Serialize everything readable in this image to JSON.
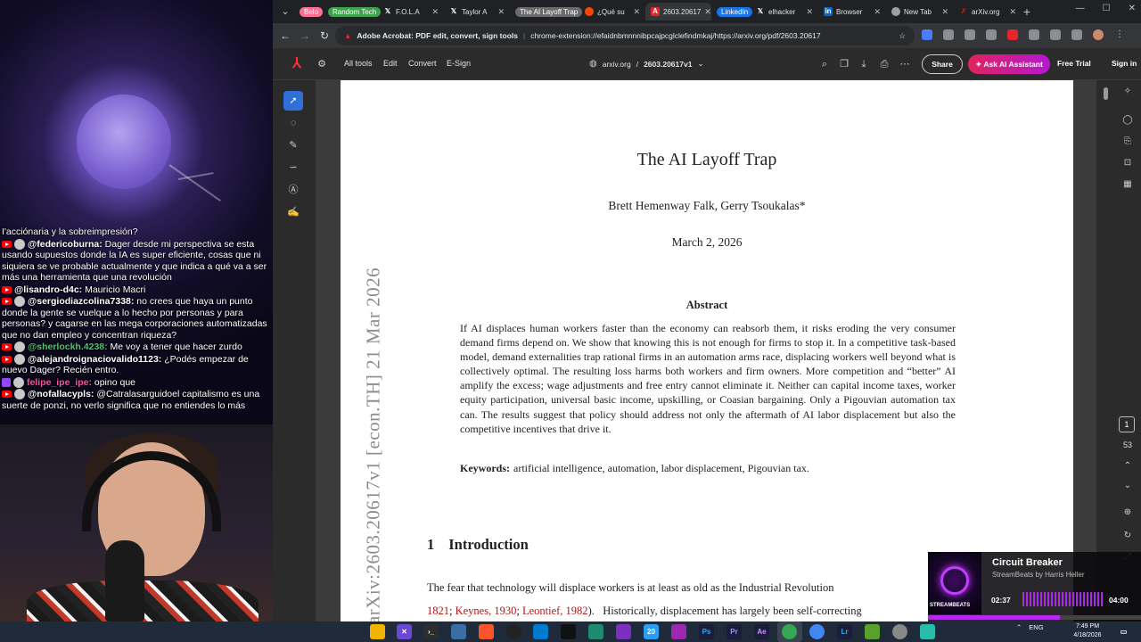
{
  "chat": {
    "messages": [
      {
        "user": "",
        "text": "I'acciónaria y la sobreimpresión?",
        "color": ""
      },
      {
        "user": "@federicoburna:",
        "text": "Dager desde mi perspectiva se esta usando supuestos donde la IA es super eficiente, cosas que ni siquiera se ve probable actualmente y que indica a qué va a ser más una herramienta que una revolución",
        "color": ""
      },
      {
        "user": "@lisandro-d4c:",
        "text": "Mauricio Macri",
        "color": ""
      },
      {
        "user": "@sergiodiazcolina7338:",
        "text": "no crees que haya un punto donde la gente se vuelque a lo hecho por personas y para personas? y cagarse en las mega corporaciones automatizadas que no dan empleo y concentran riqueza?",
        "color": ""
      },
      {
        "user": "@sherlockh.4238:",
        "text": "Me voy a tener que hacer zurdo",
        "color": "green"
      },
      {
        "user": "@alejandroignaciovalido1123:",
        "text": "¿Podés empezar de nuevo Dager? Recién entro.",
        "color": ""
      },
      {
        "user": "felipe_ipe_ipe:",
        "text": "opino que",
        "color": "pink"
      },
      {
        "user": "@nofallacypls:",
        "text": "@Catralasarguidoel capitalismo es una suerte de ponzi, no verlo significa que no entiendes lo más",
        "color": ""
      }
    ]
  },
  "browser": {
    "tabs": [
      {
        "label": "Belo",
        "type": "group",
        "color": "#ff6f91"
      },
      {
        "label": "Random Tech",
        "type": "group",
        "color": "#3fa34d"
      },
      {
        "label": "F.O.L.A",
        "type": "tab",
        "icon": "x-icon"
      },
      {
        "label": "Taylor A",
        "type": "tab",
        "icon": "x-icon"
      },
      {
        "label": "The AI Layoff Trap",
        "type": "group",
        "color": "#8a8a8a"
      },
      {
        "label": "¿Qué su",
        "type": "tab",
        "icon": "reddit-icon"
      },
      {
        "label": "2603.20617",
        "type": "tab",
        "icon": "acrobat-icon",
        "active": true
      },
      {
        "label": "LinkedIn",
        "type": "group",
        "color": "#1a73e8"
      },
      {
        "label": "elhacker",
        "type": "tab",
        "icon": "x-icon"
      },
      {
        "label": "Browser",
        "type": "tab",
        "icon": "linkedin-icon"
      },
      {
        "label": "New Tab",
        "type": "tab",
        "icon": "chrome-icon"
      },
      {
        "label": "arXiv.org",
        "type": "tab",
        "icon": "arxiv-icon"
      }
    ],
    "address": {
      "extension_label": "Adobe Acrobat: PDF edit, convert, sign tools",
      "url": "chrome-extension://efaidnbmnnnibpcajpcglclefindmkaj/https://arxiv.org/pdf/2603.20617"
    }
  },
  "acrobat": {
    "menu": [
      "All tools",
      "Edit",
      "Convert",
      "E-Sign"
    ],
    "doc_domain": "arxiv.org",
    "doc_name": "2603.20617v1",
    "share_label": "Share",
    "ai_label": "Ask AI Assistant",
    "trial_label": "Free Trial",
    "signin_label": "Sign in",
    "current_page": "1",
    "total_pages": "53"
  },
  "paper": {
    "arxiv_stamp": "arXiv:2603.20617v1  [econ.TH]  21 Mar 2026",
    "title": "The AI Layoff Trap",
    "authors": "Brett Hemenway Falk, Gerry Tsoukalas*",
    "date": "March 2, 2026",
    "abstract_heading": "Abstract",
    "abstract": "If AI displaces human workers faster than the economy can reabsorb them, it risks eroding the very consumer demand firms depend on. We show that knowing this is not enough for firms to stop it. In a competitive task-based model, demand externalities trap rational firms in an automation arms race, displacing workers well beyond what is collectively optimal. The resulting loss harms both workers and firm owners. More competition and “better” AI amplify the excess; wage adjustments and free entry cannot eliminate it. Neither can capital income taxes, worker equity participation, universal basic income, upskilling, or Coasian bargaining. Only a Pigouvian automation tax can. The results suggest that policy should address not only the aftermath of AI labor displacement but also the competitive incentives that drive it.",
    "keywords_label": "Keywords:",
    "keywords": "artificial intelligence, automation, labor displacement, Pigouvian tax.",
    "intro_number": "1",
    "intro_title": "Introduction",
    "intro_line1": "The fear that technology will displace workers is at least as old as the Industrial Revolution",
    "intro_line2_a": "1821",
    "intro_line2_b": "Keynes, 1930",
    "intro_line2_c": "Leontief, 1982",
    "intro_line2_d": "Historically, displacement has largely been self-correcting"
  },
  "now_playing": {
    "title": "Circuit Breaker",
    "artist": "StreamBeats by Harris Heller",
    "elapsed": "02:37",
    "duration": "04:00",
    "progress": 0.62,
    "brand": "STREAMBEATS"
  },
  "taskbar": {
    "lang": "ENG",
    "time": "7:49 PM",
    "date": "4/18/2026",
    "badge": "20"
  },
  "colors": {
    "accent_blue": "#2f6fd6",
    "ai_button": "#d1177a",
    "citation_red": "#b01818",
    "music_purple": "#b329f0"
  }
}
